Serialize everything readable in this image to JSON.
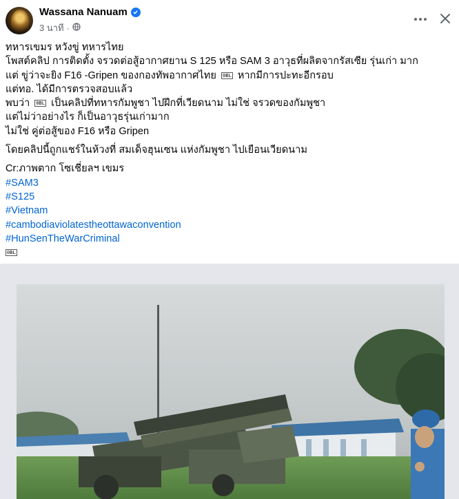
{
  "post": {
    "author": "Wassana Nanuam",
    "time": "3 นาที",
    "privacy_icon": "globe-icon",
    "lines": [
      "ทหารเขมร หวังขู่ ทหารไทย",
      "โพสต์คลิป การติดตั้ง จรวดต่อสู้อากาศยาน S 125 หรือ SAM 3 อาวุธที่ผลิตจากรัสเซีย  รุ่นเก่า มาก",
      "แต่ ขู่ว่าจะยิง F16 -Gripen ของกองทัพอากาศไทย",
      "หากมีการปะทะอีกรอบ",
      "แต่ทอ. ได้มีการตรวจสอบแล้ว",
      "พบว่า",
      "เป็นคลิปที่ทหารกัมพูชา   ไปฝึกที่เวียดนาม ไม่ใช่ จรวดของกัมพูชา",
      "แต่ไม่ว่าอย่างไร  ก็เป็นอาวุธรุ่นเก่ามาก",
      "ไม่ใช่ คู่ต่อสู้ของ F16  หรือ Gripen",
      "โดยคลิปนี้ถูกแชร์ในห้วงที่  สมเด็จฮุนเซน  แห่งกัมพูชา ไปเยือนเวียดนาม",
      "Cr:ภาพตาก โซเชี่ยลฯ เขมร"
    ],
    "emoji_marker": "0BL",
    "hashtags": [
      "#SAM3",
      "#S125",
      "#Vietnam",
      "#cambodiaviolatestheottawaconvention",
      "#HunSenTheWarCriminal"
    ]
  },
  "colors": {
    "hashtag": "#0064d1",
    "verified": "#1877f2",
    "meta": "#65676b"
  }
}
